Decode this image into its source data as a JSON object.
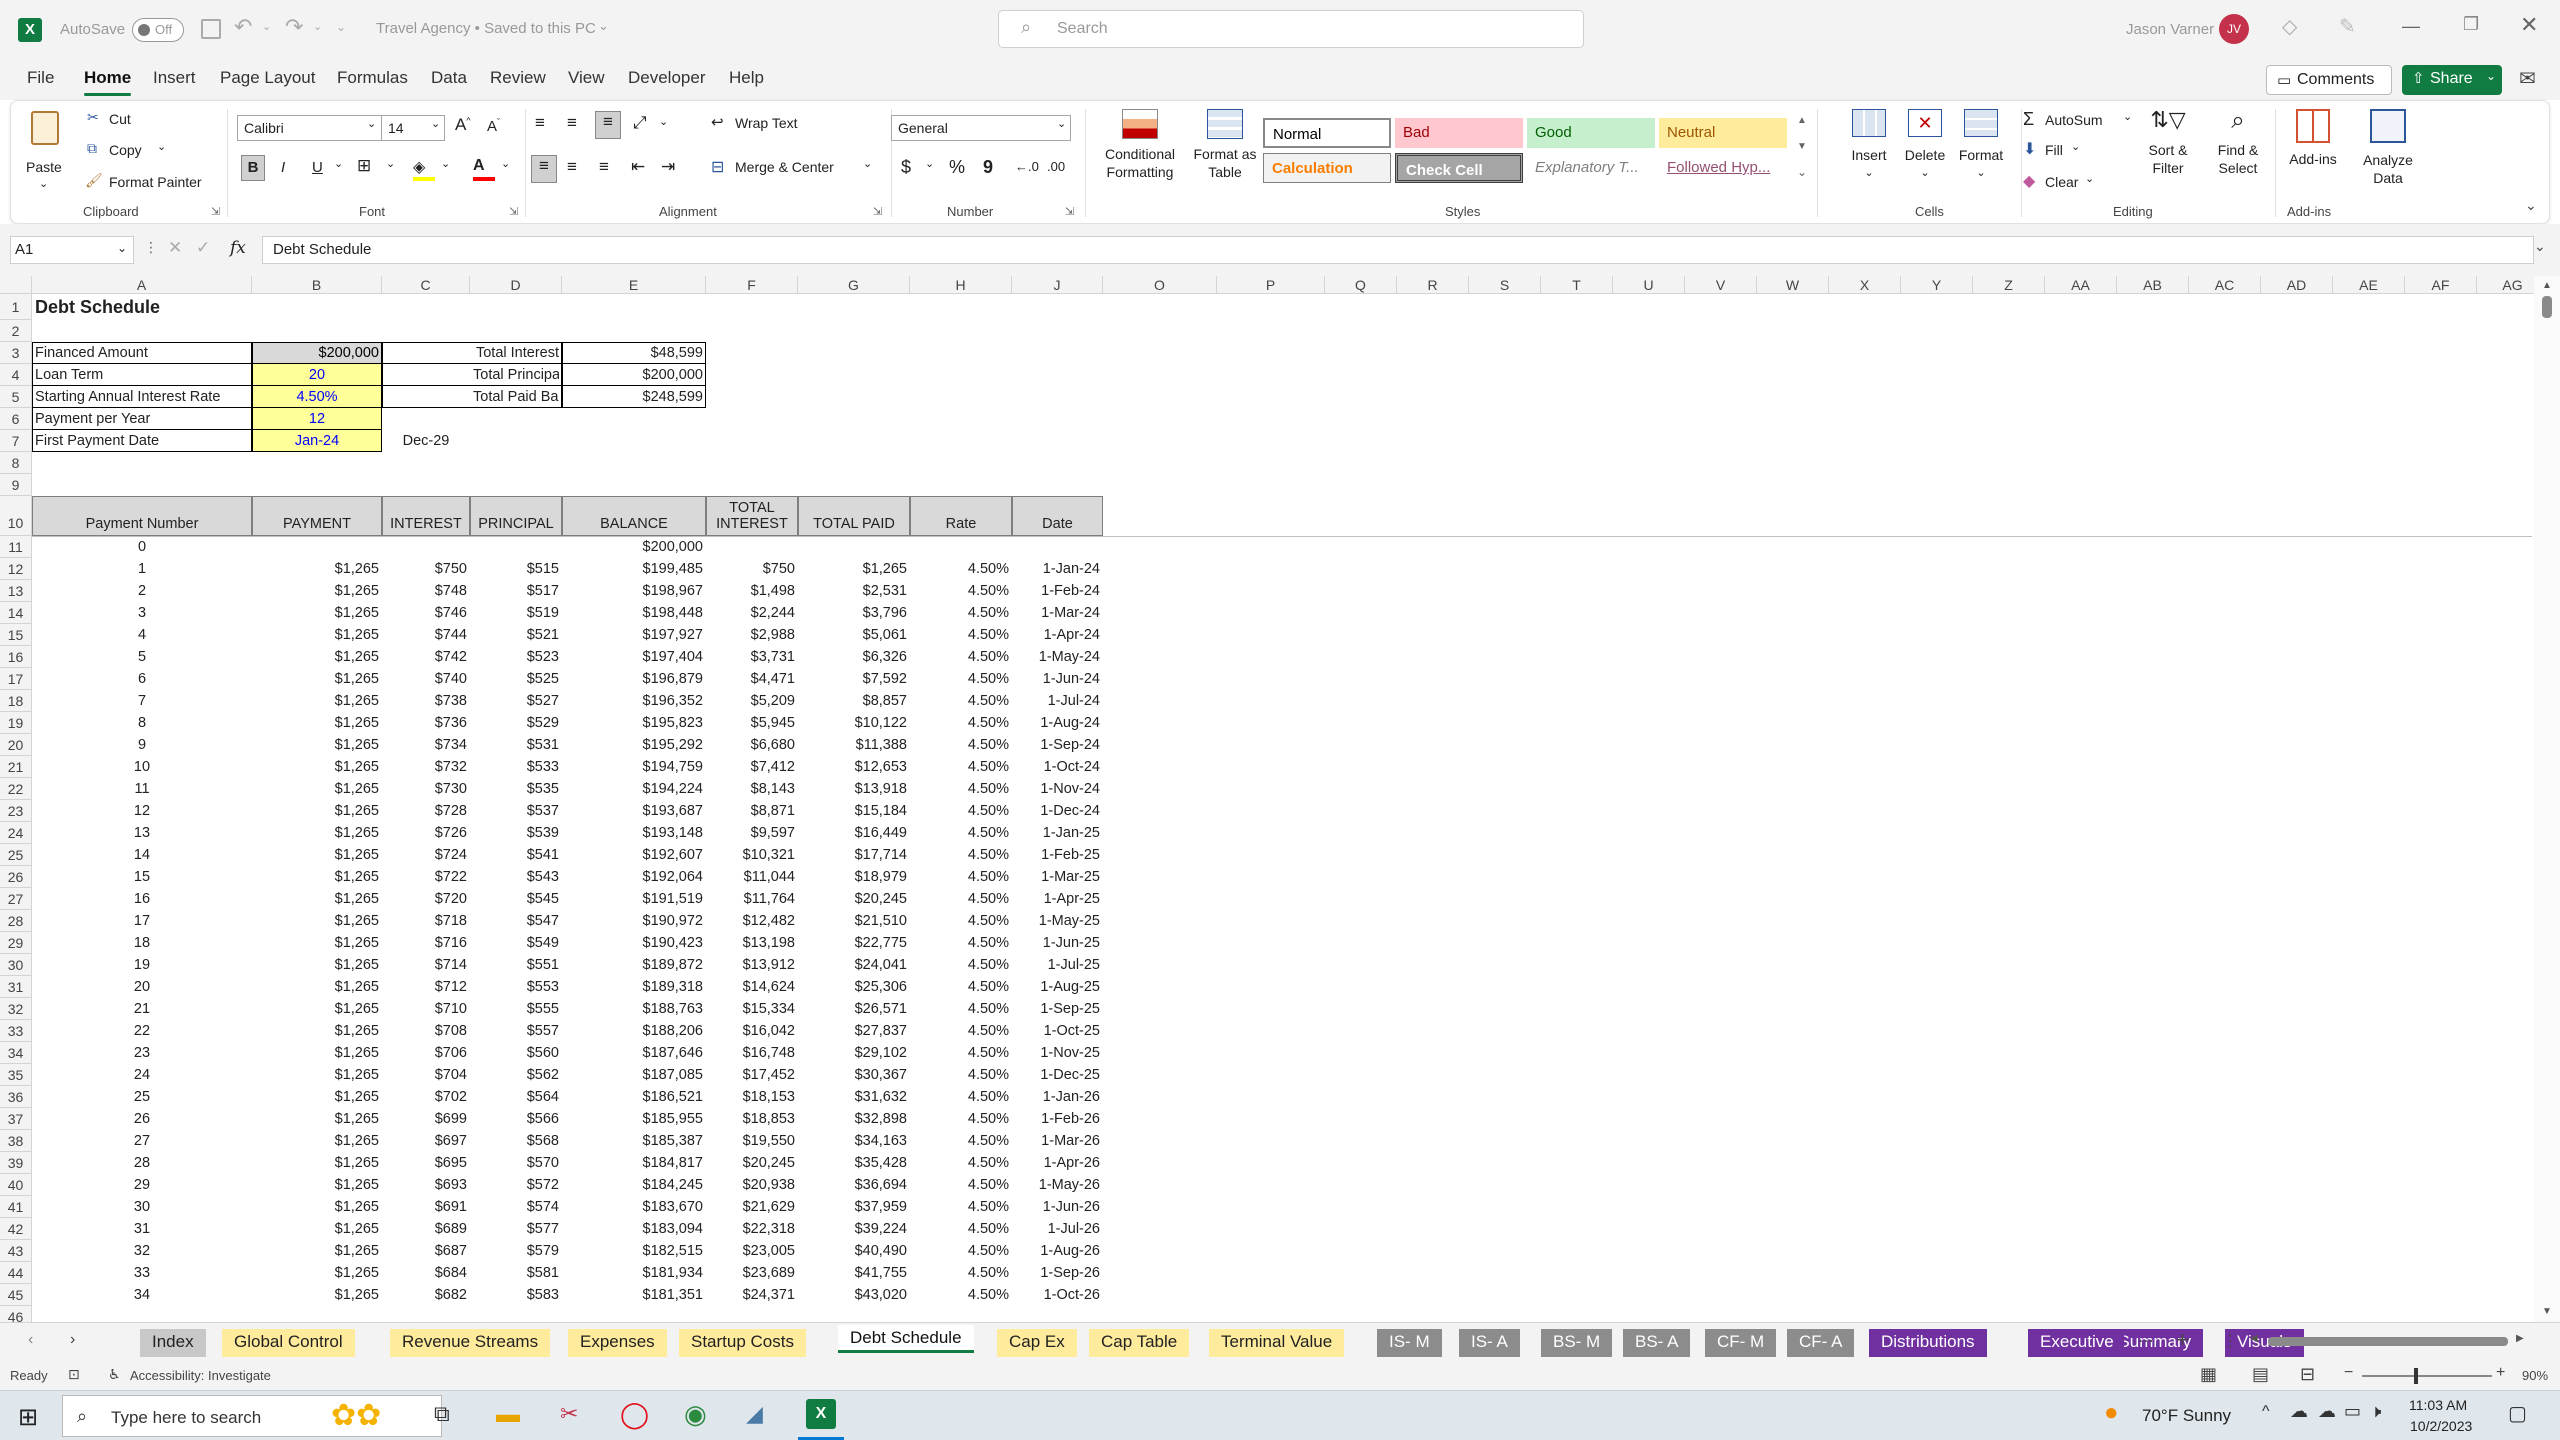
{
  "titlebar": {
    "autosave_label": "AutoSave",
    "autosave_state": "Off",
    "document_title": "Travel Agency • Saved to this PC",
    "search_placeholder": "Search",
    "user_name": "Jason Varner",
    "user_initials": "JV"
  },
  "menu": {
    "items": [
      "File",
      "Home",
      "Insert",
      "Page Layout",
      "Formulas",
      "Data",
      "Review",
      "View",
      "Developer",
      "Help"
    ],
    "active": "Home",
    "comments_label": "Comments",
    "share_label": "Share"
  },
  "ribbon": {
    "clipboard": {
      "paste": "Paste",
      "cut": "Cut",
      "copy": "Copy",
      "format_painter": "Format Painter",
      "group": "Clipboard"
    },
    "font": {
      "name": "Calibri",
      "size": "14",
      "group": "Font",
      "bold": "B",
      "italic": "I",
      "underline": "U"
    },
    "alignment": {
      "wrap_text": "Wrap Text",
      "merge_center": "Merge & Center",
      "group": "Alignment"
    },
    "number": {
      "format": "General",
      "group": "Number",
      "currency": "$",
      "percent": "%",
      "comma": "9"
    },
    "styles": {
      "conditional_formatting": "Conditional Formatting",
      "format_as_table": "Format as Table",
      "group": "Styles",
      "cells": [
        {
          "label": "Normal",
          "bg": "#ffffff",
          "fg": "#000000"
        },
        {
          "label": "Bad",
          "bg": "#ffc7ce",
          "fg": "#9c0006"
        },
        {
          "label": "Good",
          "bg": "#c6efce",
          "fg": "#006100"
        },
        {
          "label": "Neutral",
          "bg": "#ffeb9c",
          "fg": "#9c5700"
        },
        {
          "label": "Calculation",
          "bg": "#f2f2f2",
          "fg": "#fa7d00"
        },
        {
          "label": "Check Cell",
          "bg": "#a5a5a5",
          "fg": "#ffffff"
        },
        {
          "label": "Explanatory T...",
          "bg": "#ffffff",
          "fg": "#7f7f7f"
        },
        {
          "label": "Followed Hyp...",
          "bg": "#ffffff",
          "fg": "#954f72"
        }
      ]
    },
    "cells": {
      "insert": "Insert",
      "delete": "Delete",
      "format": "Format",
      "group": "Cells"
    },
    "editing": {
      "autosum": "AutoSum",
      "fill": "Fill",
      "clear": "Clear",
      "sort_filter": "Sort & Filter",
      "find_select": "Find & Select",
      "group": "Editing"
    },
    "addins": {
      "addins": "Add-ins",
      "analyze": "Analyze Data",
      "group": "Add-ins"
    }
  },
  "formula_bar": {
    "name_box": "A1",
    "fx": "fx",
    "content": "Debt Schedule"
  },
  "columns": [
    {
      "label": "A",
      "w": 220
    },
    {
      "label": "B",
      "w": 130
    },
    {
      "label": "C",
      "w": 88
    },
    {
      "label": "D",
      "w": 92
    },
    {
      "label": "E",
      "w": 144
    },
    {
      "label": "F",
      "w": 92
    },
    {
      "label": "G",
      "w": 112
    },
    {
      "label": "H",
      "w": 102
    },
    {
      "label": "I",
      "w": 0
    },
    {
      "label": "J",
      "w": 91
    },
    {
      "label": "O",
      "w": 114
    },
    {
      "label": "P",
      "w": 108
    },
    {
      "label": "Q",
      "w": 72
    },
    {
      "label": "R",
      "w": 72
    },
    {
      "label": "S",
      "w": 72
    },
    {
      "label": "T",
      "w": 72
    },
    {
      "label": "U",
      "w": 72
    },
    {
      "label": "V",
      "w": 72
    },
    {
      "label": "W",
      "w": 72
    },
    {
      "label": "X",
      "w": 72
    },
    {
      "label": "Y",
      "w": 72
    },
    {
      "label": "Z",
      "w": 72
    },
    {
      "label": "AA",
      "w": 72
    },
    {
      "label": "AB",
      "w": 72
    },
    {
      "label": "AC",
      "w": 72
    },
    {
      "label": "AD",
      "w": 72
    },
    {
      "label": "AE",
      "w": 72
    },
    {
      "label": "AF",
      "w": 72
    },
    {
      "label": "AG",
      "w": 72
    }
  ],
  "summary": {
    "title": "Debt Schedule",
    "inputs": [
      {
        "label": "Financed Amount",
        "value": "$200,000"
      },
      {
        "label": "Loan Term",
        "value": "20"
      },
      {
        "label": "Starting Annual Interest Rate",
        "value": "4.50%"
      },
      {
        "label": "Payment per Year",
        "value": "12"
      },
      {
        "label": "First Payment Date",
        "value": "Jan-24"
      }
    ],
    "end_date": "Dec-29",
    "totals": [
      {
        "label": "Total Interest",
        "value": "$48,599"
      },
      {
        "label": "Total Principal",
        "value": "$200,000"
      },
      {
        "label": "Total Paid Back",
        "value": "$248,599"
      }
    ]
  },
  "table": {
    "headers": [
      "Payment Number",
      "PAYMENT",
      "INTEREST",
      "PRINCIPAL",
      "BALANCE",
      "TOTAL INTEREST",
      "TOTAL PAID",
      "Rate",
      "Date"
    ],
    "row0": [
      "0",
      "",
      "",
      "",
      "$200,000",
      "",
      "",
      "",
      ""
    ],
    "rows": [
      [
        "1",
        "$1,265",
        "$750",
        "$515",
        "$199,485",
        "$750",
        "$1,265",
        "4.50%",
        "1-Jan-24"
      ],
      [
        "2",
        "$1,265",
        "$748",
        "$517",
        "$198,967",
        "$1,498",
        "$2,531",
        "4.50%",
        "1-Feb-24"
      ],
      [
        "3",
        "$1,265",
        "$746",
        "$519",
        "$198,448",
        "$2,244",
        "$3,796",
        "4.50%",
        "1-Mar-24"
      ],
      [
        "4",
        "$1,265",
        "$744",
        "$521",
        "$197,927",
        "$2,988",
        "$5,061",
        "4.50%",
        "1-Apr-24"
      ],
      [
        "5",
        "$1,265",
        "$742",
        "$523",
        "$197,404",
        "$3,731",
        "$6,326",
        "4.50%",
        "1-May-24"
      ],
      [
        "6",
        "$1,265",
        "$740",
        "$525",
        "$196,879",
        "$4,471",
        "$7,592",
        "4.50%",
        "1-Jun-24"
      ],
      [
        "7",
        "$1,265",
        "$738",
        "$527",
        "$196,352",
        "$5,209",
        "$8,857",
        "4.50%",
        "1-Jul-24"
      ],
      [
        "8",
        "$1,265",
        "$736",
        "$529",
        "$195,823",
        "$5,945",
        "$10,122",
        "4.50%",
        "1-Aug-24"
      ],
      [
        "9",
        "$1,265",
        "$734",
        "$531",
        "$195,292",
        "$6,680",
        "$11,388",
        "4.50%",
        "1-Sep-24"
      ],
      [
        "10",
        "$1,265",
        "$732",
        "$533",
        "$194,759",
        "$7,412",
        "$12,653",
        "4.50%",
        "1-Oct-24"
      ],
      [
        "11",
        "$1,265",
        "$730",
        "$535",
        "$194,224",
        "$8,143",
        "$13,918",
        "4.50%",
        "1-Nov-24"
      ],
      [
        "12",
        "$1,265",
        "$728",
        "$537",
        "$193,687",
        "$8,871",
        "$15,184",
        "4.50%",
        "1-Dec-24"
      ],
      [
        "13",
        "$1,265",
        "$726",
        "$539",
        "$193,148",
        "$9,597",
        "$16,449",
        "4.50%",
        "1-Jan-25"
      ],
      [
        "14",
        "$1,265",
        "$724",
        "$541",
        "$192,607",
        "$10,321",
        "$17,714",
        "4.50%",
        "1-Feb-25"
      ],
      [
        "15",
        "$1,265",
        "$722",
        "$543",
        "$192,064",
        "$11,044",
        "$18,979",
        "4.50%",
        "1-Mar-25"
      ],
      [
        "16",
        "$1,265",
        "$720",
        "$545",
        "$191,519",
        "$11,764",
        "$20,245",
        "4.50%",
        "1-Apr-25"
      ],
      [
        "17",
        "$1,265",
        "$718",
        "$547",
        "$190,972",
        "$12,482",
        "$21,510",
        "4.50%",
        "1-May-25"
      ],
      [
        "18",
        "$1,265",
        "$716",
        "$549",
        "$190,423",
        "$13,198",
        "$22,775",
        "4.50%",
        "1-Jun-25"
      ],
      [
        "19",
        "$1,265",
        "$714",
        "$551",
        "$189,872",
        "$13,912",
        "$24,041",
        "4.50%",
        "1-Jul-25"
      ],
      [
        "20",
        "$1,265",
        "$712",
        "$553",
        "$189,318",
        "$14,624",
        "$25,306",
        "4.50%",
        "1-Aug-25"
      ],
      [
        "21",
        "$1,265",
        "$710",
        "$555",
        "$188,763",
        "$15,334",
        "$26,571",
        "4.50%",
        "1-Sep-25"
      ],
      [
        "22",
        "$1,265",
        "$708",
        "$557",
        "$188,206",
        "$16,042",
        "$27,837",
        "4.50%",
        "1-Oct-25"
      ],
      [
        "23",
        "$1,265",
        "$706",
        "$560",
        "$187,646",
        "$16,748",
        "$29,102",
        "4.50%",
        "1-Nov-25"
      ],
      [
        "24",
        "$1,265",
        "$704",
        "$562",
        "$187,085",
        "$17,452",
        "$30,367",
        "4.50%",
        "1-Dec-25"
      ],
      [
        "25",
        "$1,265",
        "$702",
        "$564",
        "$186,521",
        "$18,153",
        "$31,632",
        "4.50%",
        "1-Jan-26"
      ],
      [
        "26",
        "$1,265",
        "$699",
        "$566",
        "$185,955",
        "$18,853",
        "$32,898",
        "4.50%",
        "1-Feb-26"
      ],
      [
        "27",
        "$1,265",
        "$697",
        "$568",
        "$185,387",
        "$19,550",
        "$34,163",
        "4.50%",
        "1-Mar-26"
      ],
      [
        "28",
        "$1,265",
        "$695",
        "$570",
        "$184,817",
        "$20,245",
        "$35,428",
        "4.50%",
        "1-Apr-26"
      ],
      [
        "29",
        "$1,265",
        "$693",
        "$572",
        "$184,245",
        "$20,938",
        "$36,694",
        "4.50%",
        "1-May-26"
      ],
      [
        "30",
        "$1,265",
        "$691",
        "$574",
        "$183,670",
        "$21,629",
        "$37,959",
        "4.50%",
        "1-Jun-26"
      ],
      [
        "31",
        "$1,265",
        "$689",
        "$577",
        "$183,094",
        "$22,318",
        "$39,224",
        "4.50%",
        "1-Jul-26"
      ],
      [
        "32",
        "$1,265",
        "$687",
        "$579",
        "$182,515",
        "$23,005",
        "$40,490",
        "4.50%",
        "1-Aug-26"
      ],
      [
        "33",
        "$1,265",
        "$684",
        "$581",
        "$181,934",
        "$23,689",
        "$41,755",
        "4.50%",
        "1-Sep-26"
      ],
      [
        "34",
        "$1,265",
        "$682",
        "$583",
        "$181,351",
        "$24,371",
        "$43,020",
        "4.50%",
        "1-Oct-26"
      ]
    ]
  },
  "sheet_tabs": [
    {
      "label": "Index",
      "bg": "#c8c8c8",
      "fg": "#222"
    },
    {
      "label": "Global Control",
      "bg": "#ffeb9c",
      "fg": "#222"
    },
    {
      "label": "Revenue Streams",
      "bg": "#ffeb9c",
      "fg": "#222"
    },
    {
      "label": "Expenses",
      "bg": "#ffeb9c",
      "fg": "#222"
    },
    {
      "label": "Startup Costs",
      "bg": "#ffeb9c",
      "fg": "#222"
    },
    {
      "label": "Debt Schedule",
      "bg": "#ffffff",
      "fg": "#111",
      "active": true
    },
    {
      "label": "Cap Ex",
      "bg": "#ffeb9c",
      "fg": "#222"
    },
    {
      "label": "Cap Table",
      "bg": "#ffeb9c",
      "fg": "#222"
    },
    {
      "label": "Terminal Value",
      "bg": "#ffeb9c",
      "fg": "#222"
    },
    {
      "label": "IS- M",
      "bg": "#8c8c8c",
      "fg": "#fff"
    },
    {
      "label": "IS- A",
      "bg": "#8c8c8c",
      "fg": "#fff"
    },
    {
      "label": "BS- M",
      "bg": "#8c8c8c",
      "fg": "#fff"
    },
    {
      "label": "BS- A",
      "bg": "#8c8c8c",
      "fg": "#fff"
    },
    {
      "label": "CF- M",
      "bg": "#8c8c8c",
      "fg": "#fff"
    },
    {
      "label": "CF- A",
      "bg": "#8c8c8c",
      "fg": "#fff"
    },
    {
      "label": "Distributions",
      "bg": "#7030a0",
      "fg": "#fff"
    },
    {
      "label": "Executive Summary",
      "bg": "#7030a0",
      "fg": "#fff"
    },
    {
      "label": "Visuals",
      "bg": "#7030a0",
      "fg": "#fff"
    }
  ],
  "status": {
    "ready": "Ready",
    "accessibility": "Accessibility: Investigate",
    "zoom": "90%"
  },
  "taskbar": {
    "search_placeholder": "Type here to search",
    "weather": "70°F  Sunny",
    "time": "11:03 AM",
    "date": "10/2/2023"
  },
  "colors": {
    "accent": "#107c41",
    "input_fill": "#ffff99",
    "input_text": "#0000ff",
    "table_header": "#d9d9d9"
  }
}
